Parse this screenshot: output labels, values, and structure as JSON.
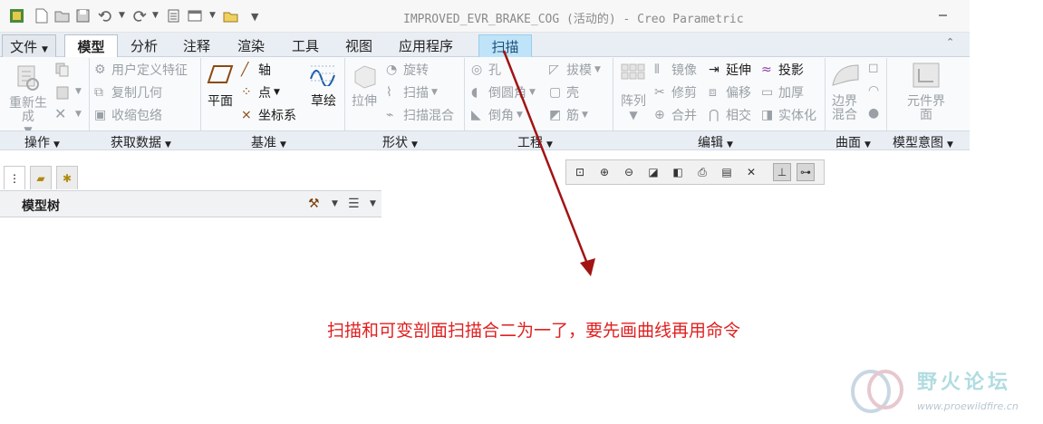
{
  "window": {
    "title": "IMPROVED_EVR_BRAKE_COG (活动的) - Creo Parametric"
  },
  "tabs": [
    {
      "label": "文件"
    },
    {
      "label": "模型"
    },
    {
      "label": "分析"
    },
    {
      "label": "注释"
    },
    {
      "label": "渲染"
    },
    {
      "label": "工具"
    },
    {
      "label": "视图"
    },
    {
      "label": "应用程序"
    },
    {
      "label": "扫描"
    }
  ],
  "ribbon": {
    "operations": {
      "regenerate": "重新生成"
    },
    "get_data": {
      "udf": "用户定义特征",
      "copy_geom": "复制几何",
      "shrinkwrap": "收缩包络"
    },
    "datum": {
      "plane": "平面",
      "axis": "轴",
      "point": "点",
      "csys": "坐标系",
      "sketch": "草绘"
    },
    "shapes": {
      "extrude": "拉伸",
      "revolve": "旋转",
      "sweep": "扫描",
      "swept_blend": "扫描混合"
    },
    "engineering": {
      "hole": "孔",
      "round": "倒圆角",
      "chamfer": "倒角",
      "draft": "拔模",
      "shell": "壳",
      "rib": "筋"
    },
    "editing": {
      "pattern": "阵列",
      "mirror": "镜像",
      "trim": "修剪",
      "merge": "合并",
      "extend": "延伸",
      "offset": "偏移",
      "intersect": "相交",
      "project": "投影",
      "thicken": "加厚",
      "solidify": "实体化"
    },
    "surfaces": {
      "boundary_blend": "边界混合"
    },
    "model_intent": {
      "component_interface": "元件界面"
    }
  },
  "groups": [
    {
      "label": "操作"
    },
    {
      "label": "获取数据"
    },
    {
      "label": "基准"
    },
    {
      "label": "形状"
    },
    {
      "label": "工程"
    },
    {
      "label": "编辑"
    },
    {
      "label": "曲面"
    },
    {
      "label": "模型意图"
    }
  ],
  "model_tree": {
    "title": "模型树"
  },
  "annotation": {
    "text": "扫描和可变剖面扫描合二为一了，要先画曲线再用命令"
  },
  "watermark": {
    "brand": "野火论坛",
    "url": "www.proewildfire.cn"
  },
  "colors": {
    "annotation": "#e02020",
    "arrow": "#a31313",
    "active_tab": "#bfe3f8"
  }
}
